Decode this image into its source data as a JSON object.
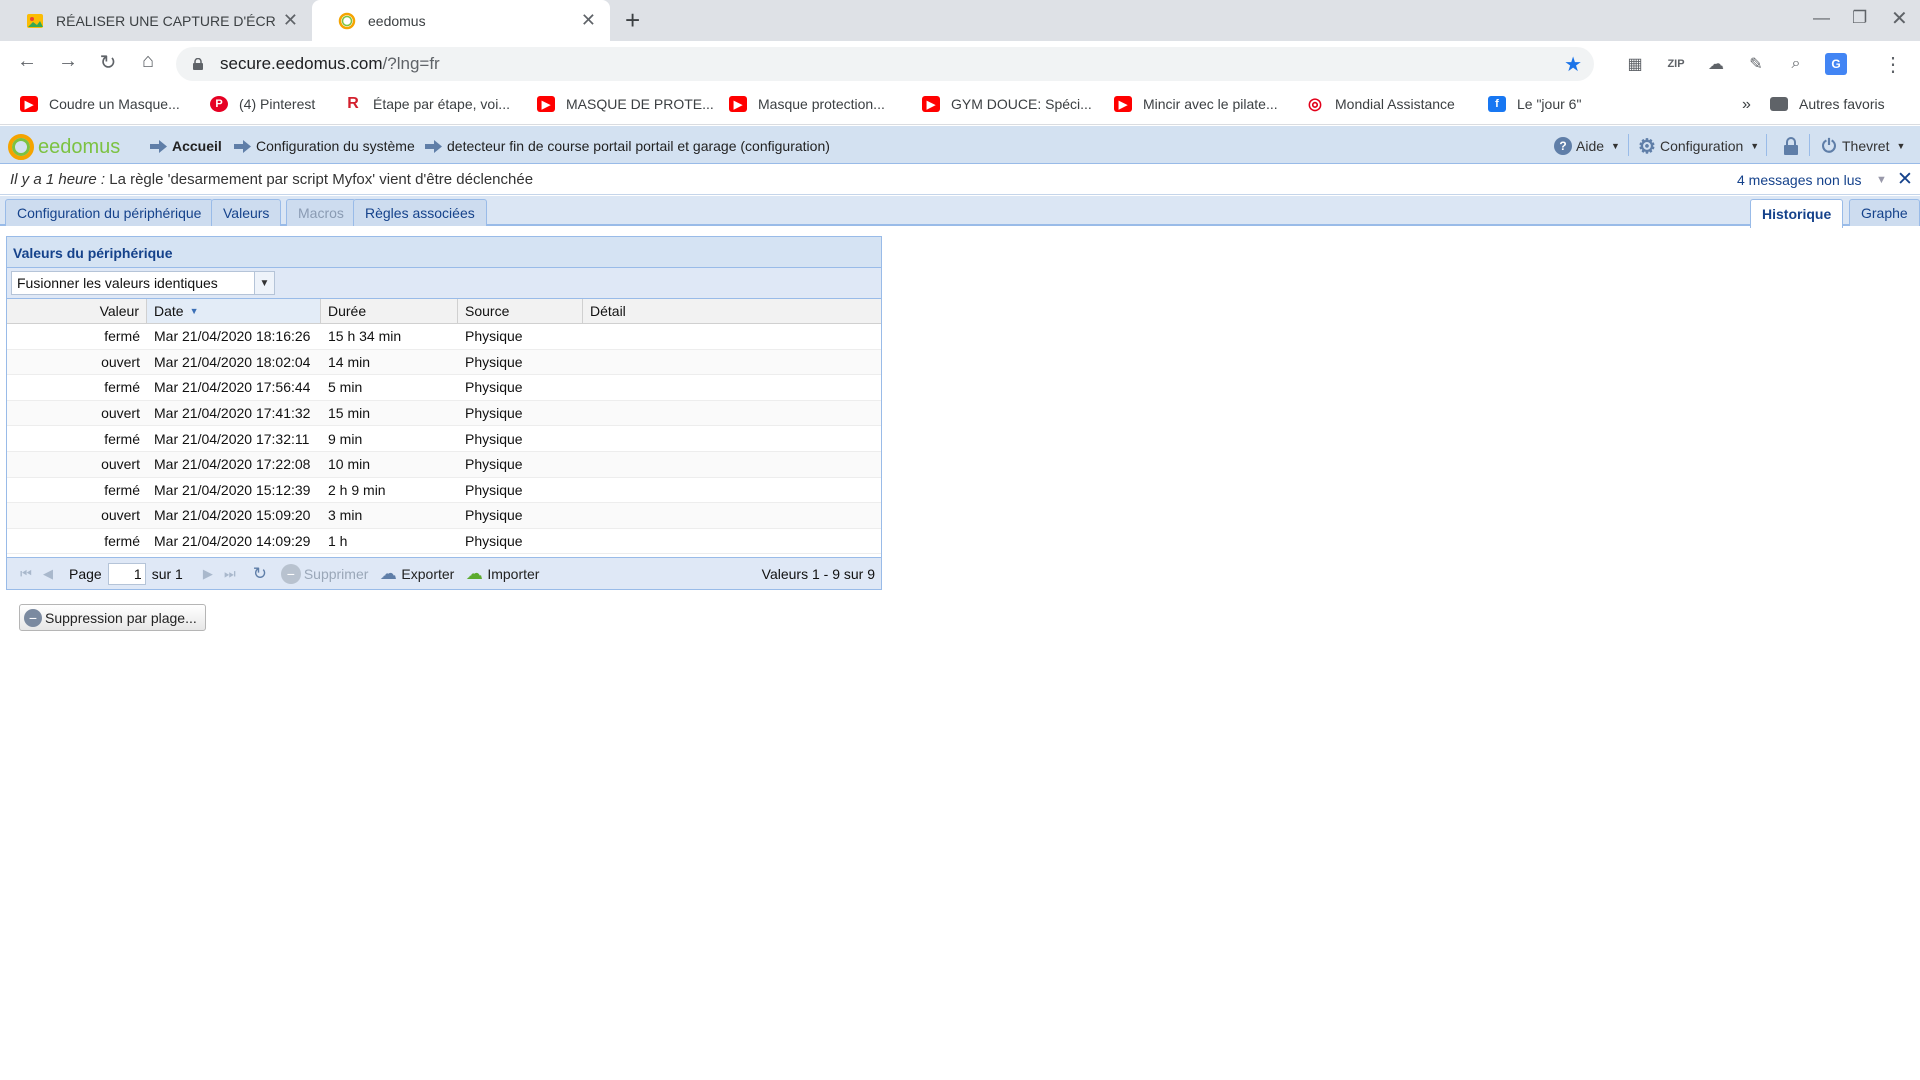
{
  "browser": {
    "tabs": [
      {
        "title": "RÉALISER UNE CAPTURE D'ÉCRAN",
        "favicon": "image-favicon-icon",
        "active": false
      },
      {
        "title": "eedomus",
        "favicon": "eedomus-favicon-icon",
        "active": true
      }
    ],
    "url_host": "secure.eedomus.com",
    "url_path": "/?lng=fr",
    "bookmarks": [
      {
        "label": "Coudre un Masque...",
        "icon": "youtube-icon",
        "color": "#ff0000"
      },
      {
        "label": "(4) Pinterest",
        "icon": "pinterest-icon",
        "color": "#e60023"
      },
      {
        "label": "Étape par étape, voi...",
        "icon": "r-logo-icon",
        "color": "#d3202d"
      },
      {
        "label": "MASQUE DE PROTE...",
        "icon": "youtube-icon",
        "color": "#ff0000"
      },
      {
        "label": "Masque protection...",
        "icon": "youtube-icon",
        "color": "#ff0000"
      },
      {
        "label": "GYM DOUCE: Spéci...",
        "icon": "youtube-icon",
        "color": "#ff0000"
      },
      {
        "label": "Mincir avec le pilate...",
        "icon": "youtube-icon",
        "color": "#ff0000"
      },
      {
        "label": "Mondial Assistance",
        "icon": "mondial-assistance-icon",
        "color": "#e2001a"
      },
      {
        "label": "Le \"jour 6\"",
        "icon": "facebook-icon",
        "color": "#1877f2"
      }
    ],
    "more_bookmarks": "»",
    "other_bookmarks": "Autres favoris"
  },
  "app": {
    "logo_text": "eedomus",
    "breadcrumb": [
      {
        "label": "Accueil",
        "bold": true
      },
      {
        "label": "Configuration du système",
        "bold": false
      },
      {
        "label": "detecteur fin de course portail portail et garage (configuration)",
        "bold": false
      }
    ],
    "menu": {
      "help": "Aide",
      "config": "Configuration",
      "user": "Thevret"
    },
    "message": {
      "time": "Il y a 1 heure :",
      "text": " La règle 'desarmement par script Myfox' vient d'être déclenchée",
      "unread": "4 messages non lus"
    },
    "tabs_left": [
      {
        "label": "Configuration du périphérique",
        "disabled": false
      },
      {
        "label": "Valeurs",
        "disabled": false
      },
      {
        "label": "Macros",
        "disabled": true
      },
      {
        "label": "Règles associées",
        "disabled": false
      }
    ],
    "tabs_right": [
      {
        "label": "Historique",
        "active": true
      },
      {
        "label": "Graphe",
        "active": false
      }
    ]
  },
  "panel": {
    "title": "Valeurs du périphérique",
    "merge_select": "Fusionner les valeurs identiques",
    "columns": [
      "Valeur",
      "Date",
      "Durée",
      "Source",
      "Détail"
    ],
    "rows": [
      [
        "fermé",
        "Mar 21/04/2020 18:16:26",
        "15 h 34 min",
        "Physique",
        ""
      ],
      [
        "ouvert",
        "Mar 21/04/2020 18:02:04",
        "14 min",
        "Physique",
        ""
      ],
      [
        "fermé",
        "Mar 21/04/2020 17:56:44",
        "5 min",
        "Physique",
        ""
      ],
      [
        "ouvert",
        "Mar 21/04/2020 17:41:32",
        "15 min",
        "Physique",
        ""
      ],
      [
        "fermé",
        "Mar 21/04/2020 17:32:11",
        "9 min",
        "Physique",
        ""
      ],
      [
        "ouvert",
        "Mar 21/04/2020 17:22:08",
        "10 min",
        "Physique",
        ""
      ],
      [
        "fermé",
        "Mar 21/04/2020 15:12:39",
        "2 h 9 min",
        "Physique",
        ""
      ],
      [
        "ouvert",
        "Mar 21/04/2020 15:09:20",
        "3 min",
        "Physique",
        ""
      ],
      [
        "fermé",
        "Mar 21/04/2020 14:09:29",
        "1 h",
        "Physique",
        ""
      ]
    ],
    "pager": {
      "page_label": "Page",
      "page_value": "1",
      "of_label": "sur 1",
      "delete": "Supprimer",
      "export": "Exporter",
      "import": "Importer",
      "info": "Valeurs 1 - 9 sur 9"
    },
    "range_delete": "Suppression par plage..."
  }
}
